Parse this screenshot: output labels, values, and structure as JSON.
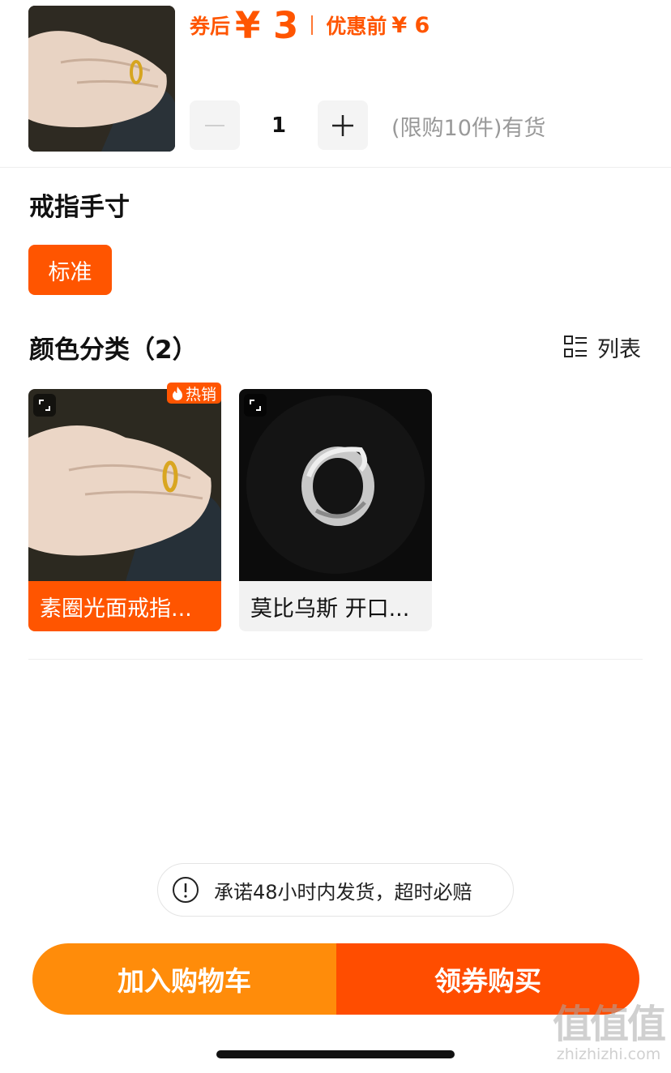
{
  "product": {
    "price_after_coupon_label": "券后",
    "price_after_coupon_value": "¥ 3",
    "price_before_label": "优惠前",
    "price_before_value": "¥ 6",
    "quantity": "1",
    "stock_text": "(限购10件)有货"
  },
  "ring_size": {
    "title": "戒指手寸",
    "options": [
      {
        "label": "标准",
        "selected": true
      }
    ]
  },
  "color": {
    "title": "颜色分类（2）",
    "list_toggle_label": "列表",
    "items": [
      {
        "caption": "素圈光面戒指...",
        "badge": "热销",
        "selected": true
      },
      {
        "caption": "莫比乌斯 开口...",
        "badge": "",
        "selected": false
      }
    ]
  },
  "notice": {
    "text": "承诺48小时内发货，超时必赔"
  },
  "actions": {
    "add_to_cart": "加入购物车",
    "buy_with_coupon": "领券购买"
  },
  "watermark": {
    "line1": "值值值",
    "line2": "zhizhizhi.com"
  },
  "colors": {
    "accent": "#ff5500",
    "cart_orange": "#ff8c0a",
    "buy_red_orange": "#ff4d00"
  },
  "icons": [
    "minus-icon",
    "plus-icon",
    "list-view-icon",
    "expand-icon",
    "flame-icon",
    "alert-circle-icon"
  ]
}
